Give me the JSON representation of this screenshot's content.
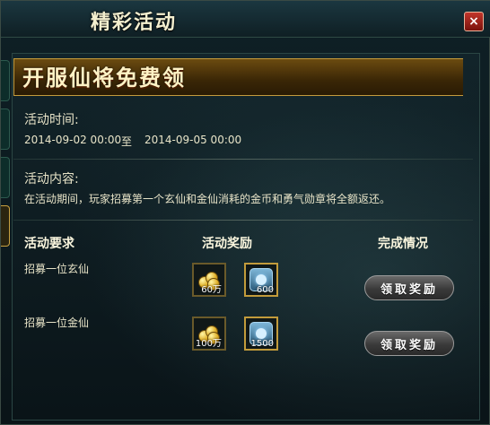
{
  "window": {
    "title": "精彩活动",
    "close_symbol": "×"
  },
  "banner": {
    "title": "开服仙将免费领"
  },
  "activity_time": {
    "label": "活动时间:",
    "start": "2014-09-02 00:00",
    "separator": "至",
    "end": "2014-09-05 00:00"
  },
  "activity_content": {
    "label": "活动内容:",
    "text": "在活动期间，玩家招募第一个玄仙和金仙消耗的金币和勇气勋章将全额返还。"
  },
  "table": {
    "headers": [
      "活动要求",
      "活动奖励",
      "完成情况"
    ],
    "rows": [
      {
        "requirement": "招募一位玄仙",
        "rewards": [
          {
            "icon": "gold-coins-icon",
            "qty": "60万"
          },
          {
            "icon": "courage-medal-icon",
            "qty": "600"
          }
        ],
        "action": "领取奖励"
      },
      {
        "requirement": "招募一位金仙",
        "rewards": [
          {
            "icon": "gold-coins-icon",
            "qty": "100万"
          },
          {
            "icon": "courage-medal-icon",
            "qty": "1500"
          }
        ],
        "action": "领取奖励"
      }
    ]
  },
  "colors": {
    "accent_gold": "#c49b3c",
    "close_red": "#b1261d"
  }
}
